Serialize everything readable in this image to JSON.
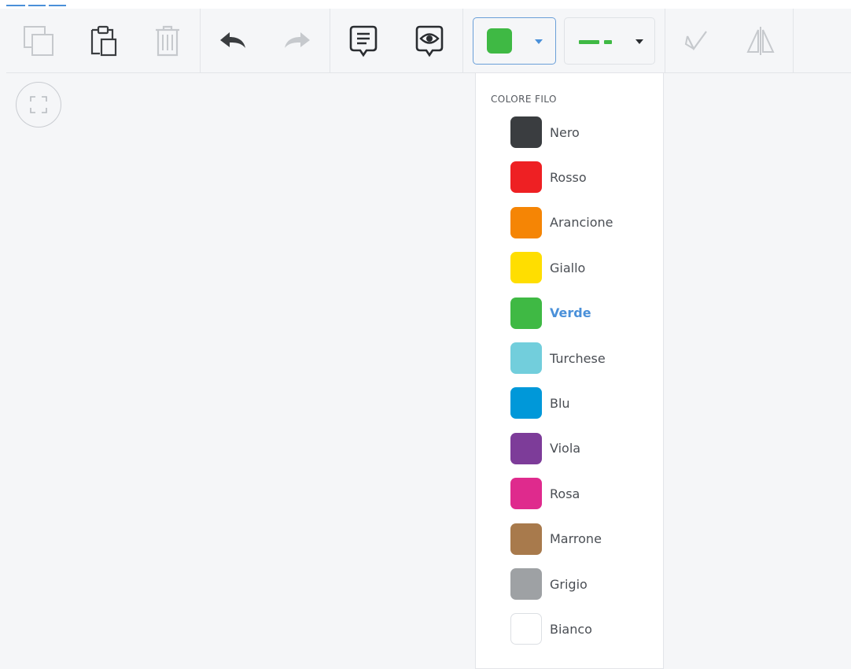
{
  "toolbar": {
    "groups": [
      {
        "buttons": [
          {
            "name": "duplicate",
            "icon": "duplicate-icon",
            "enabled": false
          },
          {
            "name": "paste",
            "icon": "clipboard-icon",
            "enabled": true
          },
          {
            "name": "delete",
            "icon": "trash-icon",
            "enabled": false
          }
        ]
      },
      {
        "buttons": [
          {
            "name": "undo",
            "icon": "undo-icon",
            "enabled": true
          },
          {
            "name": "redo",
            "icon": "redo-icon",
            "enabled": false
          }
        ]
      },
      {
        "buttons": [
          {
            "name": "comment",
            "icon": "comment-icon",
            "enabled": true
          },
          {
            "name": "view",
            "icon": "eye-comment-icon",
            "enabled": true
          }
        ]
      }
    ],
    "color_picker": {
      "selected_color": "#3fb944",
      "icon": "chevron-down-icon"
    },
    "line_picker": {
      "line_color": "#3fb944",
      "style": "dash",
      "icon": "chevron-down-icon"
    },
    "extra_tools": [
      {
        "name": "checkmark-tool",
        "icon": "check-draw-icon",
        "enabled": false
      },
      {
        "name": "mirror-tool",
        "icon": "flip-icon",
        "enabled": false
      }
    ]
  },
  "canvas": {
    "fit_button_icon": "fullscreen-icon"
  },
  "dropdown": {
    "title": "COLORE FILO",
    "colors": [
      {
        "label": "Nero",
        "hex": "#3a3d40"
      },
      {
        "label": "Rosso",
        "hex": "#ee2023"
      },
      {
        "label": "Arancione",
        "hex": "#f58505"
      },
      {
        "label": "Giallo",
        "hex": "#ffde00"
      },
      {
        "label": "Verde",
        "hex": "#3fb944",
        "selected": true
      },
      {
        "label": "Turchese",
        "hex": "#72cedc"
      },
      {
        "label": "Blu",
        "hex": "#0098d9"
      },
      {
        "label": "Viola",
        "hex": "#7d3c99"
      },
      {
        "label": "Rosa",
        "hex": "#df2a8d"
      },
      {
        "label": "Marrone",
        "hex": "#a87a4c"
      },
      {
        "label": "Grigio",
        "hex": "#9ea1a4"
      },
      {
        "label": "Bianco",
        "hex": "#ffffff"
      }
    ]
  },
  "accent_color": "#4a90d9"
}
